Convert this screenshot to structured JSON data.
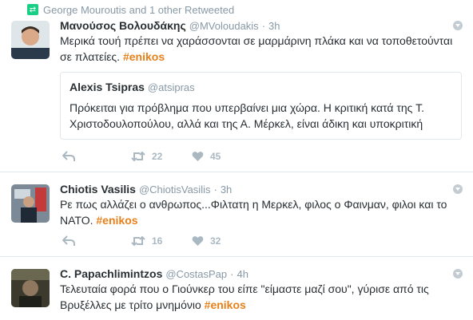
{
  "context": {
    "retweeted_by": "George Mouroutis and 1 other Retweeted",
    "icon": "retweet-icon"
  },
  "tweets": [
    {
      "fullname": "Μανούσος Βολουδάκης",
      "screen_name": "@MVoloudakis",
      "separator": "·",
      "time": "3h",
      "text_before": "Μερικά τουή πρέπει να χαράσσονται σε μαρμάρινη πλάκα και να τοποθετούνται σε πλατείες. ",
      "hashtag": "#enikos",
      "quote": {
        "fullname": "Alexis Tsipras",
        "screen_name": "@atsipras",
        "text": "Πρόκειται για πρόβλημα που υπερβαίνει μια χώρα. Η κριτική κατά της Τ. Χριστοδουλοπούλου, αλλά και της Α. Μέρκελ, είναι άδικη και υποκριτική"
      },
      "retweets": "22",
      "likes": "45"
    },
    {
      "fullname": "Chiotis Vasilis",
      "screen_name": "@ChiotisVasilis",
      "separator": "·",
      "time": "3h",
      "text_before": "Ρε πως αλλάζει ο ανθρωπος...Φιλτατη η Μερκελ, φιλος ο Φαινμαν, φιλοι και το ΝΑΤΟ. ",
      "hashtag": "#enikos",
      "retweets": "16",
      "likes": "32"
    },
    {
      "fullname": "C. Papachlimintzos",
      "screen_name": "@CostasPap",
      "separator": "·",
      "time": "4h",
      "text_before": "Τελευταία φορά που ο Γιούνκερ του είπε \"είμαστε μαζί σου\", γύρισε από τις Βρυξέλλες με τρίτο μνημόνιο ",
      "hashtag": "#enikos"
    }
  ],
  "colors": {
    "hashtag": "#e8801a",
    "secondary": "#8899a6",
    "retweet": "#19cf86"
  }
}
